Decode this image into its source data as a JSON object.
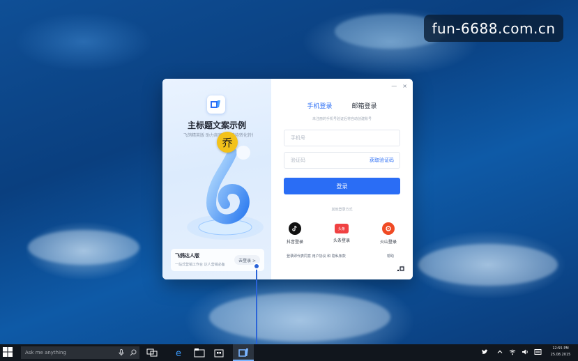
{
  "watermark": {
    "text": "fun-6688.com.cn"
  },
  "login_window": {
    "left": {
      "title": "主标题文案示例",
      "subtitle": "飞鸽精英版 助力商家高效接待转化转化服务",
      "badge": "乔",
      "promo": {
        "title": "飞鸽达人版",
        "description": "一站式营销工作台 达人营销必备",
        "button": "去登录 >"
      }
    },
    "controls": {
      "minimize": "—",
      "close": "×"
    },
    "tabs": [
      {
        "label": "手机登录",
        "active": true
      },
      {
        "label": "邮箱登录",
        "active": false
      }
    ],
    "hint": "未注册的手机号验证后将自动创建账号",
    "phone_placeholder": "手机号",
    "code_placeholder": "验证码",
    "get_code": "获取验证码",
    "login_button": "登录",
    "other_methods_label": "其他登录方式",
    "social": [
      {
        "label": "抖音登录",
        "icon": "douyin-icon",
        "color": "#111111"
      },
      {
        "label": "头条登录",
        "icon": "toutiao-icon",
        "color": "#f04142",
        "glyph": "头条"
      },
      {
        "label": "火山登录",
        "icon": "huoshan-icon",
        "color": "#f04a24"
      }
    ],
    "agreement": "登录即代表同意 用户协议 和 隐私条款",
    "help": "帮助",
    "accent_color": "#2a6df5"
  },
  "taskbar": {
    "search_placeholder": "Ask me anything",
    "clock_time": "12:55 PM",
    "clock_date": "25.08.2015"
  }
}
